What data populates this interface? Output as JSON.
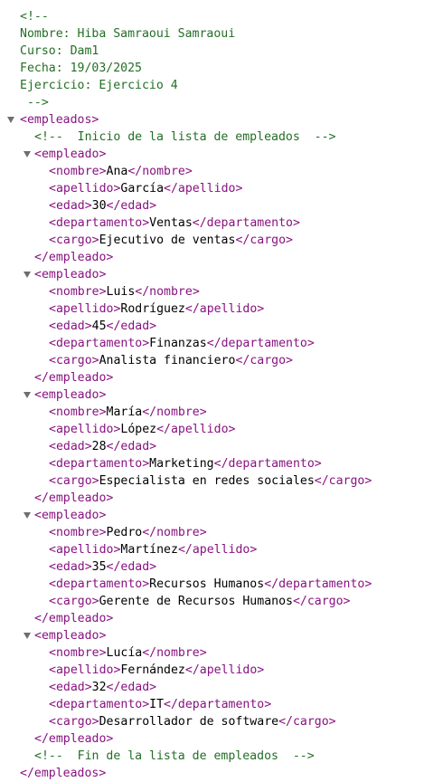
{
  "header_comment": [
    "<!--",
    "Nombre: Hiba Samraoui Samraoui",
    "Curso: Dam1",
    "Fecha: 19/03/2025",
    "Ejercicio: Ejercicio 4",
    " -->"
  ],
  "root_tag": "empleados",
  "start_comment": "<!--  Inicio de la lista de empleados  -->",
  "end_comment": "<!--  Fin de la lista de empleados  -->",
  "item_tag": "empleado",
  "field_tags": [
    "nombre",
    "apellido",
    "edad",
    "departamento",
    "cargo"
  ],
  "empleados": [
    {
      "nombre": "Ana",
      "apellido": "García",
      "edad": "30",
      "departamento": "Ventas",
      "cargo": "Ejecutivo de ventas"
    },
    {
      "nombre": "Luis",
      "apellido": "Rodríguez",
      "edad": "45",
      "departamento": "Finanzas",
      "cargo": "Analista financiero"
    },
    {
      "nombre": "María",
      "apellido": "López",
      "edad": "28",
      "departamento": "Marketing",
      "cargo": "Especialista en redes sociales"
    },
    {
      "nombre": "Pedro",
      "apellido": "Martínez",
      "edad": "35",
      "departamento": "Recursos Humanos",
      "cargo": "Gerente de Recursos Humanos"
    },
    {
      "nombre": "Lucía",
      "apellido": "Fernández",
      "edad": "32",
      "departamento": "IT",
      "cargo": "Desarrollador de software"
    }
  ],
  "colors": {
    "tag": "#881280",
    "comment": "#236e25",
    "text": "#000000",
    "toggle": "#6e6e6e"
  },
  "icons": {
    "collapse_toggle": "triangle-down-icon"
  }
}
